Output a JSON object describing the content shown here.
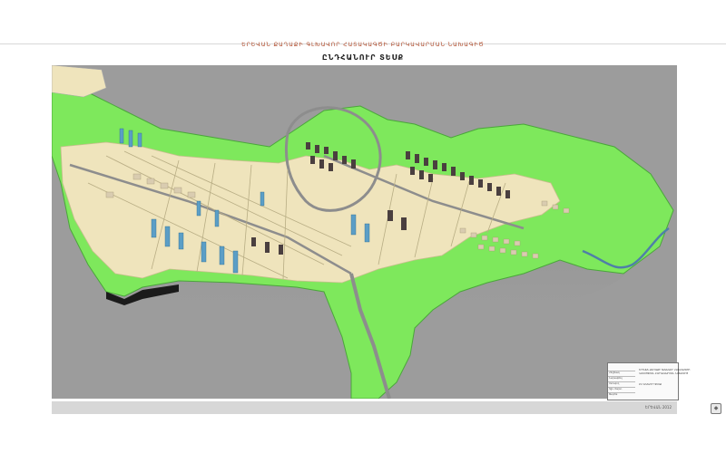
{
  "sheet": {
    "title": "ԵՐԵՎԱՆ ՔԱՂԱՔԻ ԳԼԽԱՎՈՐ ՀԱՏԱԿԱԳԾԻ ԲԱՐԿԱՎԱՐՄԱՆ ՆԱԽԱԳԻԾ",
    "subtitle": "ԸՆԴՀԱՆՈՒՐ ՏԵՍՔ"
  },
  "title_block": {
    "org_lines": [
      "ԵՐԵՎԱՆ ՔԱՂԱՔԻ ԳԼԽԱՎՈՐ ՀԱՏԱԿԱԳԾԻ",
      "ԿԱՌՈՒՑՄԱՆ ԲԱՐԿԱՎԱՐՄԱՆ ՆԱԽԱԳԻԾ"
    ],
    "drawing_name": "ԸՆԴՀԱՆՈՒՐ ՏԵՍՔ",
    "rows": [
      "Հեղինակ",
      "Նախագծող",
      "Ստուգող",
      "Գլխ. ճարտ.",
      "Տնօրեն"
    ]
  },
  "footer": {
    "label": "ԵՐԵՎԱՆ 2012"
  },
  "colors": {
    "green": "#7ee85c",
    "ground": "#efe4bc",
    "road": "#8d8d8d",
    "background": "#9c9c9c"
  }
}
